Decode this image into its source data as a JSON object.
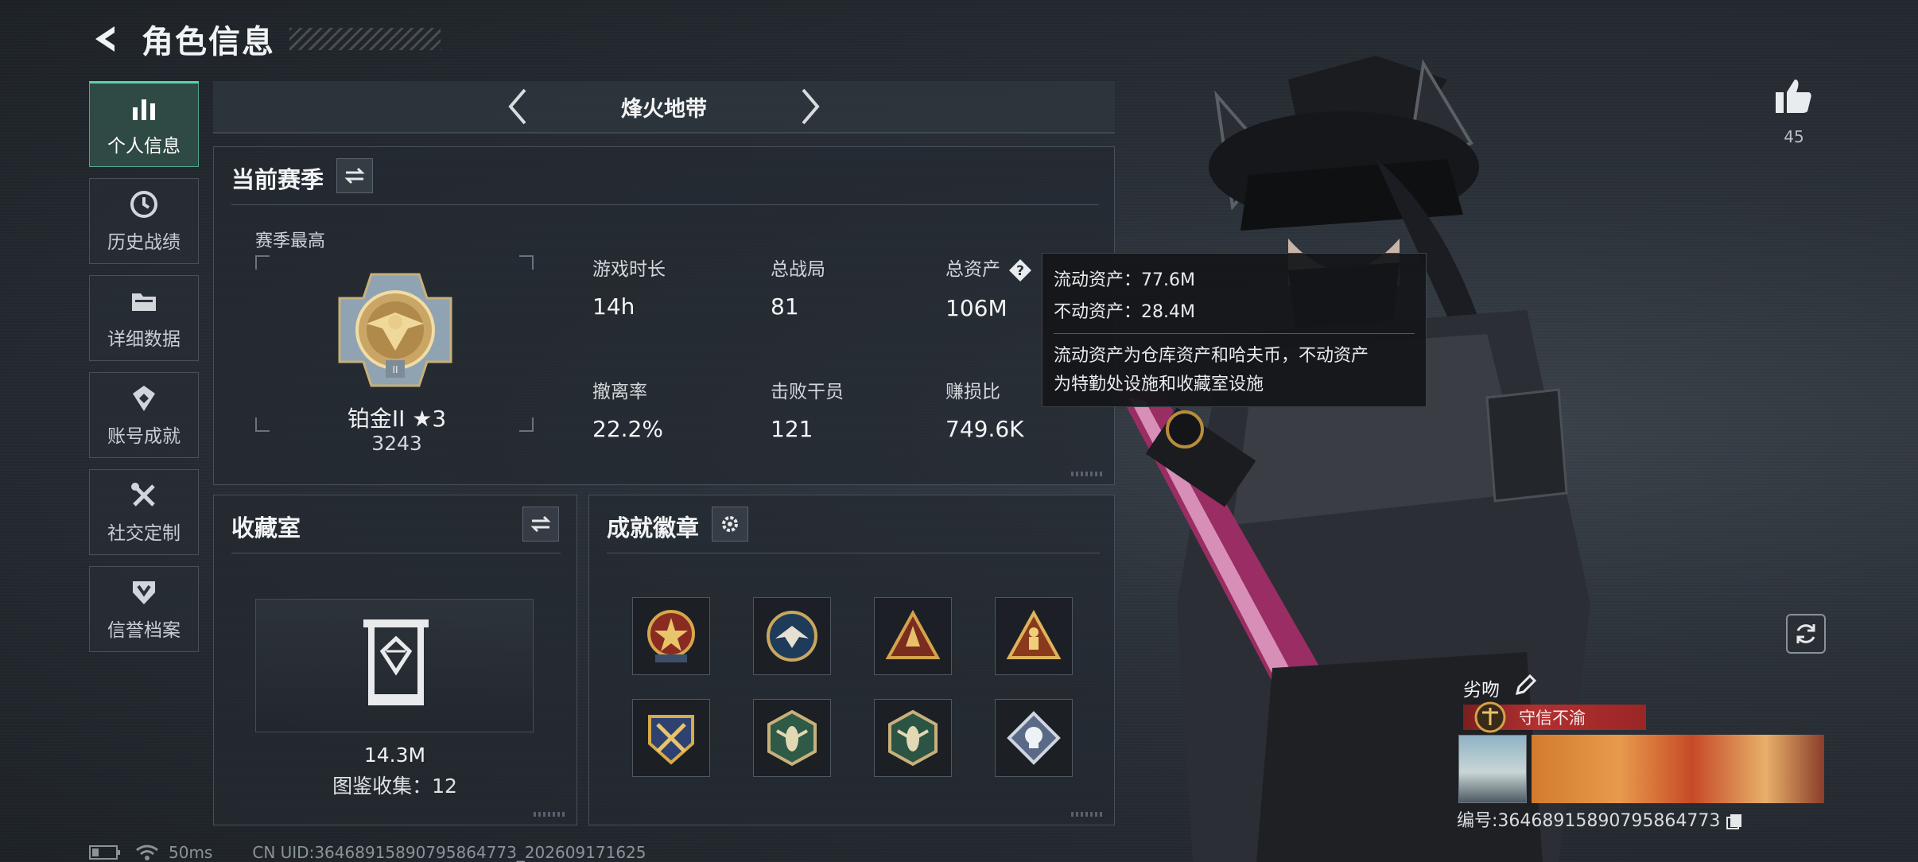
{
  "header": {
    "title": "角色信息"
  },
  "sidebar": {
    "items": [
      {
        "label": "个人信息",
        "icon": "bar-chart-icon",
        "active": true
      },
      {
        "label": "历史战绩",
        "icon": "clock-icon"
      },
      {
        "label": "详细数据",
        "icon": "folder-icon"
      },
      {
        "label": "账号成就",
        "icon": "achievement-icon"
      },
      {
        "label": "社交定制",
        "icon": "tools-icon"
      },
      {
        "label": "信誉档案",
        "icon": "shield-icon"
      }
    ]
  },
  "mode": {
    "label": "烽火地带"
  },
  "season": {
    "title": "当前赛季",
    "best_label": "赛季最高",
    "rank_name": "铂金II ★3",
    "rank_score": "3243",
    "stats": [
      {
        "label": "游戏时长",
        "value": "14h"
      },
      {
        "label": "总战局",
        "value": "81"
      },
      {
        "label": "总资产",
        "value": "106M"
      },
      {
        "label": "撤离率",
        "value": "22.2%"
      },
      {
        "label": "击败干员",
        "value": "121"
      },
      {
        "label": "赚损比",
        "value": "749.6K"
      }
    ]
  },
  "tooltip": {
    "liquid": "流动资产：77.6M",
    "fixed": "不动资产：28.4M",
    "desc_line1": "流动资产为仓库资产和哈夫币，不动资产",
    "desc_line2": "为特勤处设施和收藏室设施"
  },
  "collection": {
    "title": "收藏室",
    "value": "14.3M",
    "count_text": "图鉴收集：12"
  },
  "badges": {
    "title": "成就徽章",
    "items": [
      "star-emblem-icon",
      "eagle-emblem-icon",
      "triangle-emblem-icon",
      "soldier-triangle-icon",
      "crossed-swords-emblem-icon",
      "hornet-hex-icon",
      "hornet-hex-2-icon",
      "diamond-skull-icon"
    ]
  },
  "likes": {
    "count": "45"
  },
  "profile": {
    "nickname": "劣吻",
    "title_badge": "守信不渝",
    "uid_text": "编号:3646891589079586477​3"
  },
  "status": {
    "ping": "50ms",
    "uid_full": "CN UID:3646891589079586477​3_202609171625"
  },
  "colors": {
    "accent_green": "#5bd3a6",
    "title_red": "#b23030"
  }
}
